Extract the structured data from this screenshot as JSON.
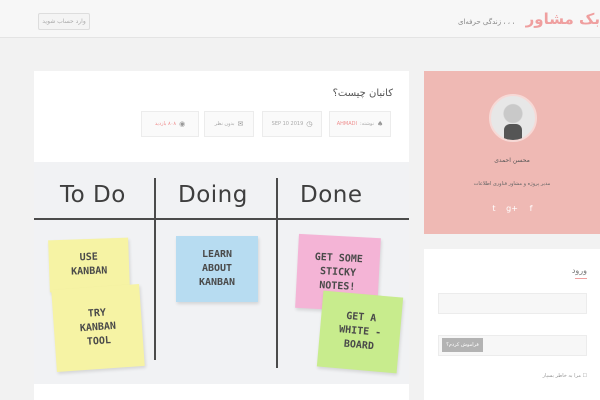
{
  "header": {
    "site_title": "بک مشاور",
    "tagline": "، ، ، زندگی حرفه‌ای",
    "login_button": "وارد حساب شوید"
  },
  "post": {
    "title": "کانبان چیست؟",
    "meta": [
      {
        "icon": "user-icon",
        "label": "نوشته:",
        "value": "AHMADI"
      },
      {
        "icon": "clock-icon",
        "label": "",
        "value": "SEP 10 2019"
      },
      {
        "icon": "comment-icon",
        "label": "",
        "value": "بدون نظر"
      },
      {
        "icon": "eye-icon",
        "label": "",
        "value": "۸۰۸ بازدید"
      }
    ],
    "image": {
      "columns": [
        "To Do",
        "Doing",
        "Done"
      ],
      "notes": [
        {
          "text": "USE\nKANBAN",
          "color": "#f6f3a4"
        },
        {
          "text": "TRY\nKANBAN\nTOOL",
          "color": "#f6f3a4"
        },
        {
          "text": "LEARN\nABOUT\nKANBAN",
          "color": "#b7dcf1"
        },
        {
          "text": "GET SOME\nSTICKY\nNOTES!",
          "color": "#f4b4d6"
        },
        {
          "text": "GET A\nWHITE -\nBOARD",
          "color": "#c8ec8d"
        }
      ]
    }
  },
  "sidebar": {
    "profile": {
      "name": "محسن احمدی",
      "description": "مدیر پروژه و مشاور فناوری اطلاعات",
      "social": [
        "facebook-icon",
        "google-plus-icon",
        "twitter-icon"
      ]
    },
    "login": {
      "title": "ورود",
      "forgot_button": "فراموش کردم؟",
      "remember_label": "مرا به خاطر بسپار"
    }
  },
  "colors": {
    "accent": "#ef9f9f",
    "profile_bg": "#efb9b4"
  }
}
